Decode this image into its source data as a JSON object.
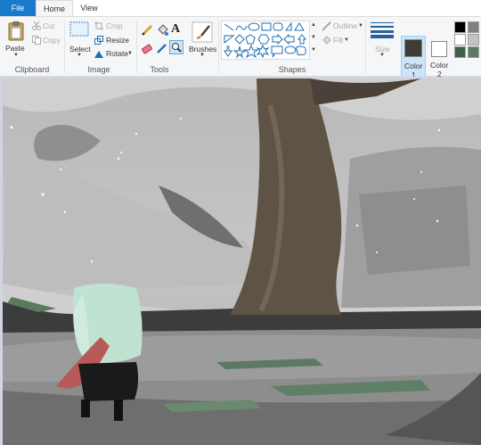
{
  "tabs": {
    "file": "File",
    "home": "Home",
    "view": "View"
  },
  "clipboard": {
    "paste": "Paste",
    "cut": "Cut",
    "copy": "Copy",
    "group": "Clipboard"
  },
  "image": {
    "select": "Select",
    "crop": "Crop",
    "resize": "Resize",
    "rotate": "Rotate",
    "group": "Image"
  },
  "tools": {
    "group": "Tools"
  },
  "brushes": {
    "label": "Brushes"
  },
  "shapes": {
    "outline": "Outline",
    "fill": "Fill",
    "group": "Shapes"
  },
  "size": {
    "label": "Size"
  },
  "color1": {
    "label": "Color",
    "num": "1",
    "value": "#3d3c35"
  },
  "color2": {
    "label": "Color",
    "num": "2",
    "value": "#ffffff"
  },
  "palette": [
    "#000000",
    "#7f7f7f",
    "#ffffff",
    "#c3c3c3",
    "#3f5f4a",
    "#5a7a63"
  ]
}
